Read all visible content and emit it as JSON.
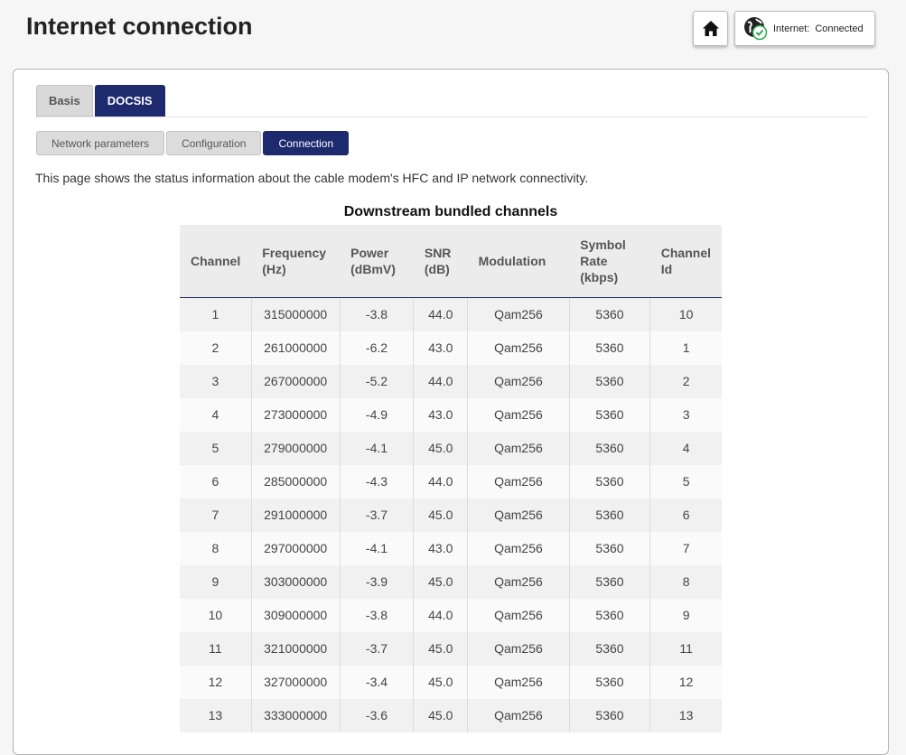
{
  "header": {
    "title": "Internet connection",
    "status_label": "Internet:",
    "status_value": "Connected"
  },
  "tabs": [
    {
      "label": "Basis",
      "active": false
    },
    {
      "label": "DOCSIS",
      "active": true
    }
  ],
  "subtabs": [
    {
      "label": "Network parameters",
      "active": false
    },
    {
      "label": "Configuration",
      "active": false
    },
    {
      "label": "Connection",
      "active": true
    }
  ],
  "description": "This page shows the status information about the cable modem's HFC and IP network connectivity.",
  "downstream": {
    "title": "Downstream bundled channels",
    "columns": [
      "Channel",
      "Frequency (Hz)",
      "Power (dBmV)",
      "SNR (dB)",
      "Modulation",
      "Symbol Rate (kbps)",
      "Channel Id"
    ],
    "rows": [
      [
        "1",
        "315000000",
        "-3.8",
        "44.0",
        "Qam256",
        "5360",
        "10"
      ],
      [
        "2",
        "261000000",
        "-6.2",
        "43.0",
        "Qam256",
        "5360",
        "1"
      ],
      [
        "3",
        "267000000",
        "-5.2",
        "44.0",
        "Qam256",
        "5360",
        "2"
      ],
      [
        "4",
        "273000000",
        "-4.9",
        "43.0",
        "Qam256",
        "5360",
        "3"
      ],
      [
        "5",
        "279000000",
        "-4.1",
        "45.0",
        "Qam256",
        "5360",
        "4"
      ],
      [
        "6",
        "285000000",
        "-4.3",
        "44.0",
        "Qam256",
        "5360",
        "5"
      ],
      [
        "7",
        "291000000",
        "-3.7",
        "45.0",
        "Qam256",
        "5360",
        "6"
      ],
      [
        "8",
        "297000000",
        "-4.1",
        "43.0",
        "Qam256",
        "5360",
        "7"
      ],
      [
        "9",
        "303000000",
        "-3.9",
        "45.0",
        "Qam256",
        "5360",
        "8"
      ],
      [
        "10",
        "309000000",
        "-3.8",
        "44.0",
        "Qam256",
        "5360",
        "9"
      ],
      [
        "11",
        "321000000",
        "-3.7",
        "45.0",
        "Qam256",
        "5360",
        "11"
      ],
      [
        "12",
        "327000000",
        "-3.4",
        "45.0",
        "Qam256",
        "5360",
        "12"
      ],
      [
        "13",
        "333000000",
        "-3.6",
        "45.0",
        "Qam256",
        "5360",
        "13"
      ]
    ]
  },
  "colors": {
    "accent": "#1e2a6e",
    "status_ok": "#2ea84f"
  },
  "icons": {
    "home": "home-icon",
    "status": "globe-check-icon"
  }
}
